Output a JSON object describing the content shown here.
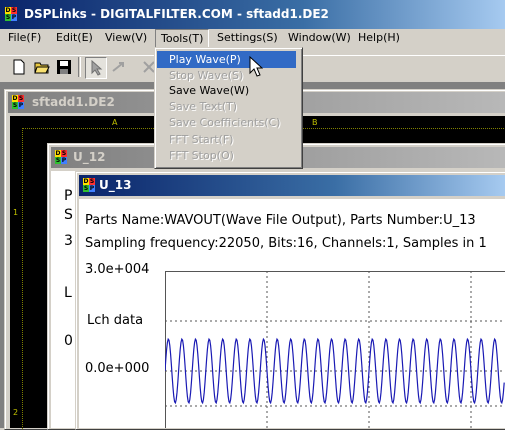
{
  "app": {
    "title": "DSPLinks - DIGITALFILTER.COM - sftadd1.DE2"
  },
  "menubar": [
    {
      "label": "File(F)"
    },
    {
      "label": "Edit(E)"
    },
    {
      "label": "View(V)"
    },
    {
      "label": "Tools(T)"
    },
    {
      "label": "Settings(S)"
    },
    {
      "label": "Window(W)"
    },
    {
      "label": "Help(H)"
    }
  ],
  "tools_menu": [
    {
      "label": "Play Wave(P)",
      "state": "highlighted"
    },
    {
      "label": "Stop Wave(S)",
      "state": "disabled"
    },
    {
      "label": "Save Wave(W)",
      "state": "enabled"
    },
    {
      "label": "Save Text(T)",
      "state": "disabled"
    },
    {
      "label": "Save Coefficients(C)",
      "state": "disabled"
    },
    {
      "label": "FFT Start(F)",
      "state": "disabled"
    },
    {
      "label": "FFT Stop(O)",
      "state": "disabled"
    }
  ],
  "toolbar_icons": [
    "new-icon",
    "open-icon",
    "save-icon",
    "pointer-icon",
    "link-tool-icon",
    "stop-tool-icon"
  ],
  "sftadd1_window": {
    "title": "sftadd1.DE2",
    "ruler_top": [
      "A",
      "B"
    ],
    "ruler_left": [
      "1",
      "2"
    ]
  },
  "u12_window": {
    "title": "U_12",
    "partial_text": [
      "P",
      "S",
      "3",
      "L",
      "0"
    ]
  },
  "u13_window": {
    "title": "U_13",
    "info_line1": "Parts Name:WAVOUT(Wave File Output), Parts Number:U_13",
    "info_line2": "Sampling frequency:22050, Bits:16, Channels:1, Samples in 1",
    "y_top_label": "3.0e+004",
    "channel_label": "Lch data",
    "y_mid_label": "0.0e+000"
  },
  "colors": {
    "title_active": "#0a246a",
    "title_inactive": "#808080",
    "menu_highlight": "#316ac5",
    "wave": "#1a1ab4",
    "grid": "#555555",
    "design_bg": "#000000",
    "ruler_text": "#c0c000"
  }
}
